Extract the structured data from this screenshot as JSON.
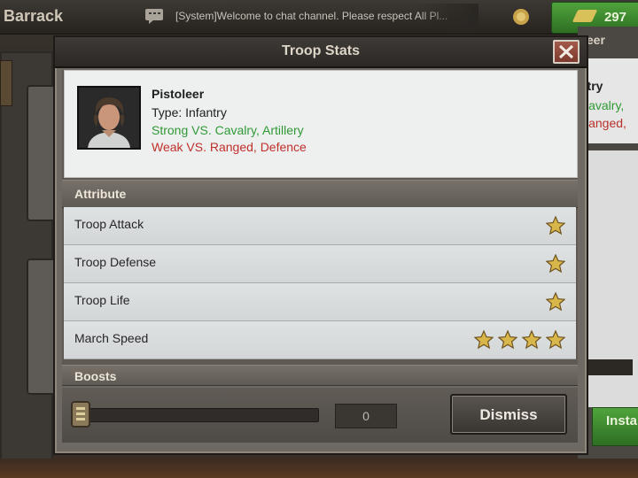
{
  "background": {
    "title": "Barrack",
    "chat": {
      "text": "[System]Welcome to chat channel. Please respect All Pl...",
      "icon": "chat-bubble-icon"
    },
    "gold_button_value": "297",
    "right_panel": {
      "title": "leer",
      "name": "ntry",
      "strong": "Cavalry,",
      "weak": "Ranged,"
    },
    "instant_label": "Insta"
  },
  "modal": {
    "title": "Troop Stats",
    "close_icon": "close-icon",
    "unit": {
      "name": "Pistoleer",
      "type": "Type: Infantry",
      "strong": "Strong VS. Cavalry, Artillery",
      "weak": "Weak VS. Ranged, Defence",
      "portrait": "unit-portrait"
    },
    "attribute_header": "Attribute",
    "attributes": [
      {
        "label": "Troop Attack",
        "stars": 1
      },
      {
        "label": "Troop Defense",
        "stars": 1
      },
      {
        "label": "Troop Life",
        "stars": 1
      },
      {
        "label": "March Speed",
        "stars": 4
      }
    ],
    "boosts_header": "Boosts",
    "quantity": {
      "value": "0",
      "slider_fraction": 0
    },
    "dismiss_label": "Dismiss"
  },
  "colors": {
    "strong": "#2f9a35",
    "weak": "#c0302a",
    "star": "#d8b64a"
  }
}
